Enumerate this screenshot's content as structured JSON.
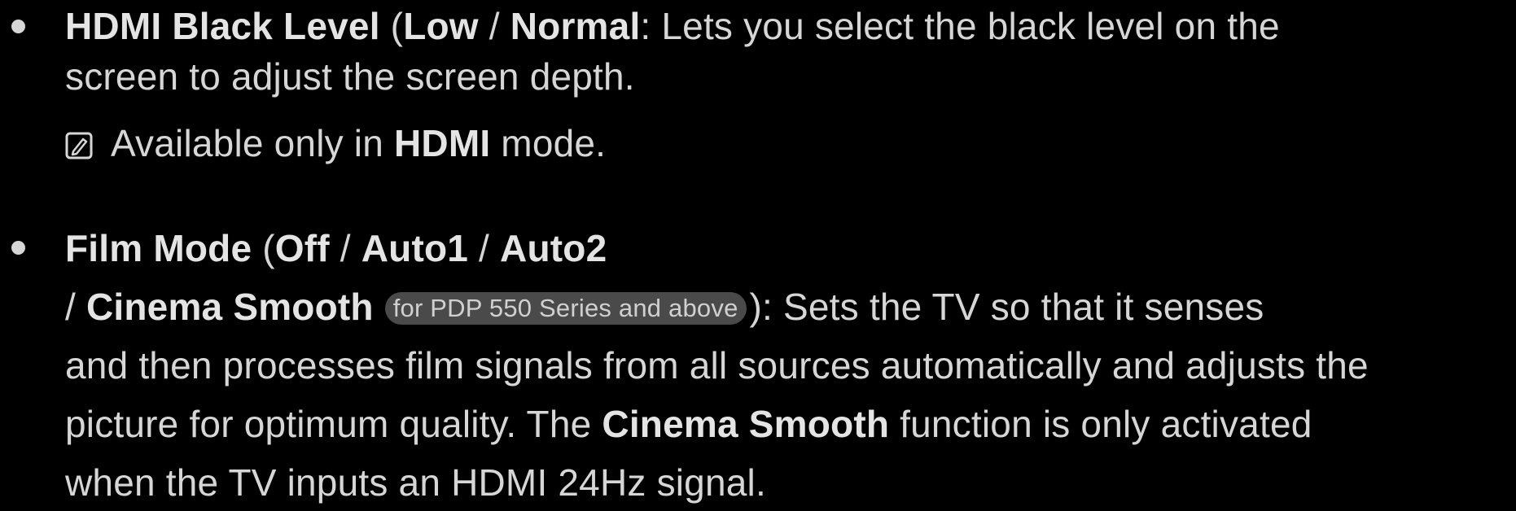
{
  "items": [
    {
      "title": "HDMI Black Level",
      "options": [
        "Low",
        "Normal"
      ],
      "description_line1": ": Lets you select the black level on the",
      "description_line2": "screen to adjust the screen depth.",
      "note": {
        "icon": "note-icon",
        "prefix": "Available only in ",
        "emphasis": "HDMI",
        "suffix": " mode."
      }
    },
    {
      "title": "Film Mode",
      "options": [
        "Off",
        "Auto1",
        "Auto2",
        "Cinema Smooth"
      ],
      "tag": "for PDP 550 Series and above",
      "description_after_tag": "): Sets the TV so that it senses",
      "description_line3": "and then processes film signals from all sources automatically and adjusts the",
      "description_line4_prefix": "picture for optimum quality. The ",
      "description_line4_emphasis": "Cinema Smooth",
      "description_line4_suffix": " function is only activated",
      "description_line5": "when the TV inputs an HDMI 24Hz signal."
    }
  ],
  "colors": {
    "background": "#000000",
    "text": "#d6d6d6",
    "bold_text": "#e4e4e4",
    "tag_background": "#4a4a4a"
  }
}
